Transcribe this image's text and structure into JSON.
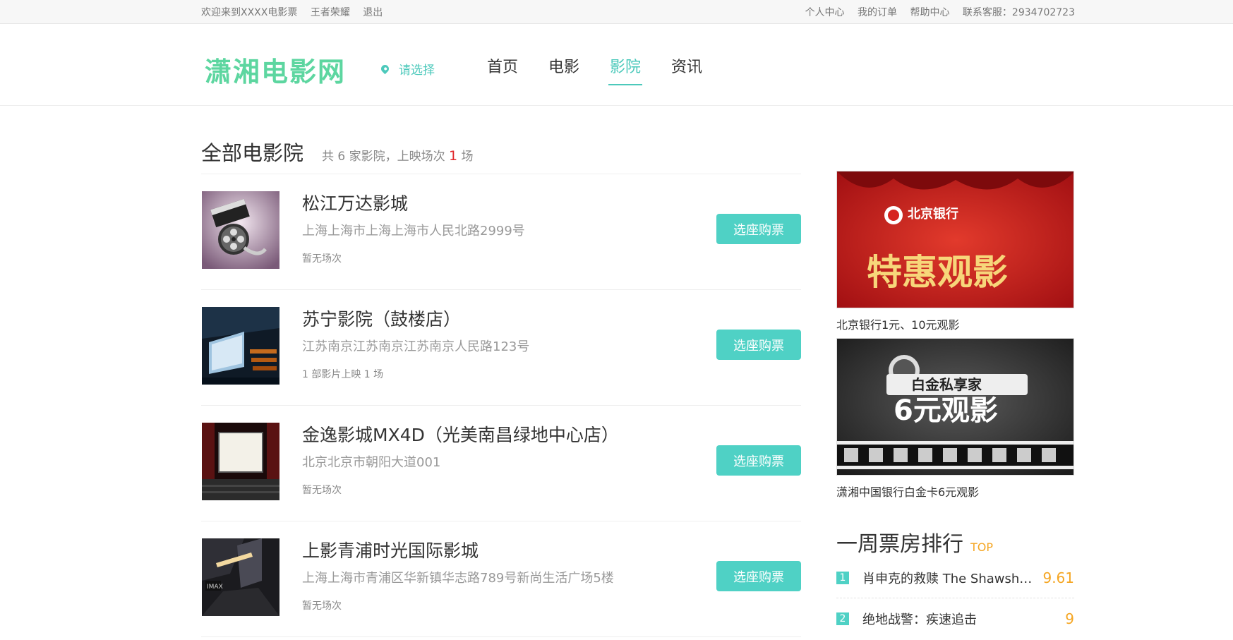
{
  "topbar": {
    "welcome": "欢迎来到XXXX电影票",
    "username": "王者荣耀",
    "logout": "退出",
    "links": [
      "个人中心",
      "我的订单",
      "帮助中心",
      "联系客服：2934702723"
    ]
  },
  "header": {
    "logo": "潇湘电影网",
    "city": "请选择",
    "nav": [
      {
        "label": "首页",
        "active": false
      },
      {
        "label": "电影",
        "active": false
      },
      {
        "label": "影院",
        "active": true
      },
      {
        "label": "资讯",
        "active": false
      }
    ]
  },
  "main": {
    "title": "全部电影院",
    "summary_prefix": "共 6 家影院，上映场次",
    "summary_count": "1",
    "summary_suffix": "场",
    "buy_label": "选座购票",
    "cinemas": [
      {
        "name": "松江万达影城",
        "address": "上海上海市上海上海市人民北路2999号",
        "shows": "暂无场次",
        "thumb": "film-reel-icon"
      },
      {
        "name": "苏宁影院（鼓楼店）",
        "address": "江苏南京江苏南京江苏南京人民路123号",
        "shows": "1 部影片上映 1 场",
        "thumb": "cinema-hall-image"
      },
      {
        "name": "金逸影城MX4D（光美南昌绿地中心店）",
        "address": "北京北京市朝阳大道001",
        "shows": "暂无场次",
        "thumb": "screen-image"
      },
      {
        "name": "上影青浦时光国际影城",
        "address": "上海上海市青浦区华新镇华志路789号新尚生活广场5楼",
        "shows": "暂无场次",
        "thumb": "imax-lobby-image"
      }
    ]
  },
  "sidebar": {
    "ads": [
      {
        "caption": "北京银行1元、10元观影",
        "text": "特惠观影",
        "bank": "北京银行"
      },
      {
        "caption": "潇湘中国银行白金卡6元观影",
        "text": "6元观影",
        "sub": "白金私享家"
      }
    ],
    "rank_title": "一周票房排行",
    "rank_tag": "TOP",
    "rank": [
      {
        "num": "1",
        "name": "肖申克的救赎 The Shawshank...",
        "score": "9.61"
      },
      {
        "num": "2",
        "name": "绝地战警：疾速追击",
        "score": "9"
      }
    ]
  },
  "colors": {
    "accent": "#4fd1c5",
    "logo": "#5dd6a0",
    "score": "#f5a623",
    "highlight": "#e0262a"
  }
}
